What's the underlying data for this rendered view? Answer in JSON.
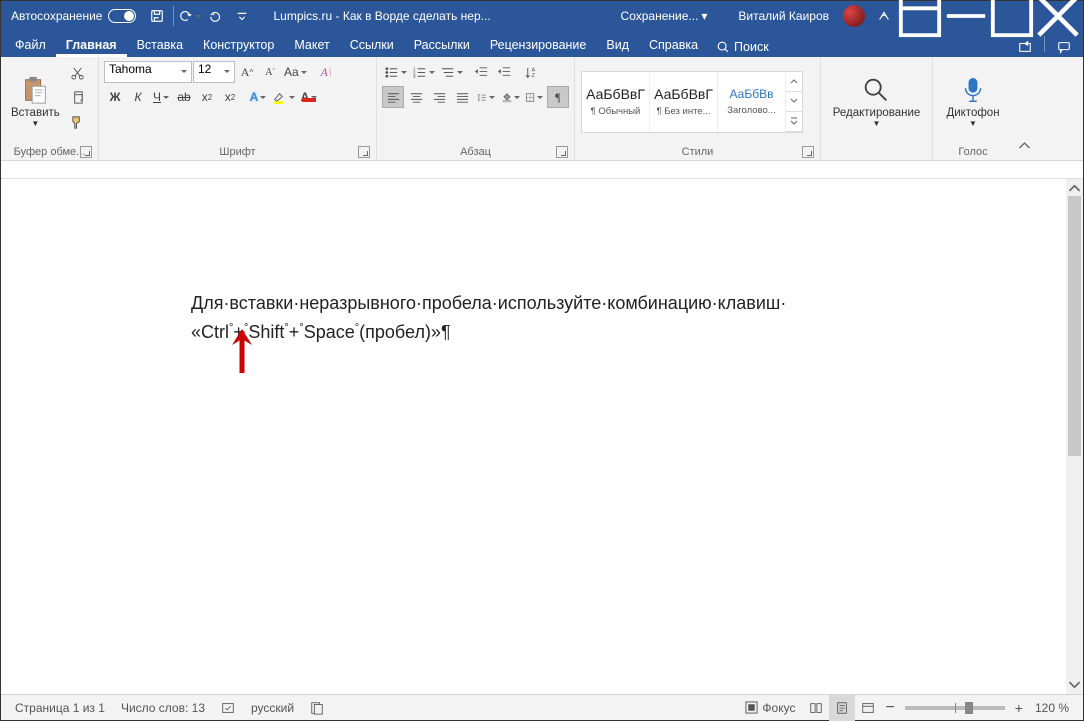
{
  "titlebar": {
    "autosave": "Автосохранение",
    "doc_title": "Lumpics.ru - Как в Ворде сделать нер...",
    "saving": "Сохранение...",
    "user": "Виталий Каиров"
  },
  "tabs": {
    "file": "Файл",
    "home": "Главная",
    "insert": "Вставка",
    "design": "Конструктор",
    "layout": "Макет",
    "references": "Ссылки",
    "mailings": "Рассылки",
    "review": "Рецензирование",
    "view": "Вид",
    "help": "Справка",
    "search": "Поиск"
  },
  "ribbon": {
    "clipboard": {
      "paste": "Вставить",
      "label": "Буфер обме..."
    },
    "font": {
      "name": "Tahoma",
      "size": "12",
      "bold": "Ж",
      "italic": "К",
      "underline": "Ч",
      "strike": "ab",
      "label": "Шрифт"
    },
    "paragraph": {
      "label": "Абзац"
    },
    "styles": {
      "label": "Стили",
      "items": [
        {
          "sample": "АаБбВвГ",
          "name": "¶ Обычный"
        },
        {
          "sample": "АаБбВвГ",
          "name": "¶ Без инте..."
        },
        {
          "sample": "АаБбВв",
          "name": "Заголово..."
        }
      ]
    },
    "editing": {
      "label": "Редактирование"
    },
    "voice": {
      "dictate": "Диктофон",
      "label": "Голос"
    }
  },
  "document": {
    "line1": "Для·вставки·неразрывного·пробела·используйте·комбинацию·клавиш·",
    "line2_a": "«Ctrl",
    "line2_b": "+",
    "line2_c": "Shift",
    "line2_d": "+",
    "line2_e": "Space",
    "line2_f": "(пробел)»¶",
    "nbsp": "°"
  },
  "statusbar": {
    "page": "Страница 1 из 1",
    "words": "Число слов: 13",
    "lang": "русский",
    "focus": "Фокус",
    "zoom": "120 %"
  }
}
